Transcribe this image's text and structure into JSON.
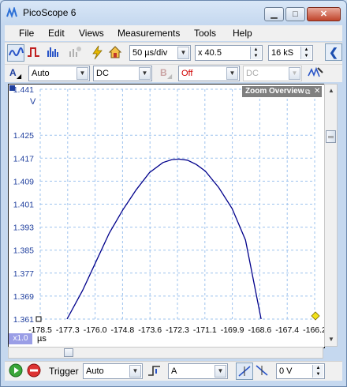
{
  "window": {
    "title": "PicoScope 6"
  },
  "menu": [
    "File",
    "Edit",
    "Views",
    "Measurements",
    "Tools",
    "Help"
  ],
  "toolbar": {
    "timebase": "50 µs/div",
    "zoom": "x 40.5",
    "samples": "16 kS"
  },
  "channel_a": {
    "letter": "A",
    "range": "Auto",
    "coupling": "DC"
  },
  "channel_b": {
    "letter": "B",
    "range": "Off",
    "coupling": "DC"
  },
  "scope": {
    "zoom_overview_label": "Zoom Overview",
    "y_unit": "V",
    "x_unit": "µs",
    "zoom_factor": "x1.0",
    "y_top_label": "1.441"
  },
  "bottombar": {
    "trigger_label": "Trigger",
    "trigger_mode": "Auto",
    "trigger_source": "A",
    "trigger_level": "0 V"
  },
  "chart_data": {
    "type": "line",
    "xlabel": "µs",
    "ylabel": "V",
    "x_ticks": [
      "-178.5",
      "-177.3",
      "-176.0",
      "-174.8",
      "-173.6",
      "-172.3",
      "-171.1",
      "-169.9",
      "-168.6",
      "-167.4",
      "-166.2"
    ],
    "y_ticks": [
      "1.441",
      "1.425",
      "1.417",
      "1.409",
      "1.401",
      "1.393",
      "1.385",
      "1.377",
      "1.369",
      "1.361"
    ],
    "xlim": [
      -178.5,
      -166.2
    ],
    "ylim": [
      1.361,
      1.441
    ],
    "grid": true,
    "series": [
      {
        "color": "#00008b",
        "x": [
          -177.3,
          -176.6,
          -176.0,
          -175.4,
          -174.8,
          -174.2,
          -173.6,
          -173.0,
          -172.6,
          -172.3,
          -171.9,
          -171.5,
          -171.1,
          -170.5,
          -169.9,
          -169.3,
          -168.6
        ],
        "y": [
          1.361,
          1.371,
          1.381,
          1.391,
          1.399,
          1.406,
          1.412,
          1.4155,
          1.4165,
          1.4167,
          1.4163,
          1.4148,
          1.4125,
          1.4068,
          1.3995,
          1.3885,
          1.361
        ]
      }
    ]
  }
}
